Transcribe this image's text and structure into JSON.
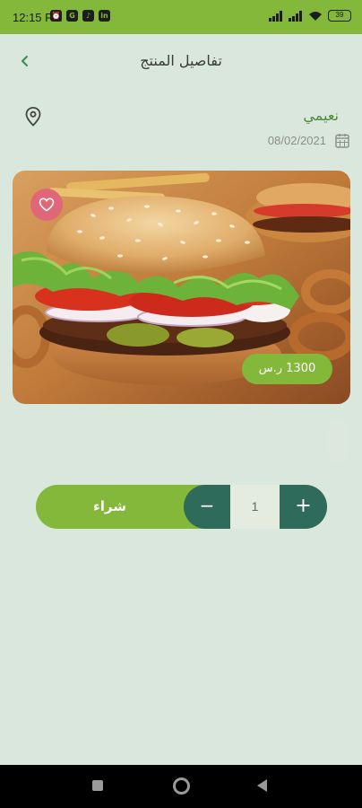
{
  "status_bar": {
    "time": "12:15 PM",
    "left_icons": [
      "alarm-clock-icon",
      "app-icon",
      "tiktok-icon",
      "linkedin-icon"
    ],
    "right_icons": [
      "signal-icon",
      "signal-icon",
      "wifi-icon"
    ],
    "battery": "39"
  },
  "header": {
    "title": "تفاصيل المنتج",
    "back_icon": "chevron-left-icon"
  },
  "seller": {
    "name": "نعيمي",
    "date": "08/02/2021",
    "location_icon": "location-pin-icon",
    "calendar_icon": "calendar-icon"
  },
  "product": {
    "image": "burger-photo",
    "favorite_icon": "heart-icon",
    "price": "1300 ر.س"
  },
  "purchase": {
    "buy_label": "شراء",
    "quantity": "1",
    "minus_label": "−",
    "plus_label": "+"
  },
  "colors": {
    "accent": "#84b83a",
    "dark_green": "#2f6b5a",
    "background": "#d9e7dc",
    "favorite": "#e06778"
  }
}
